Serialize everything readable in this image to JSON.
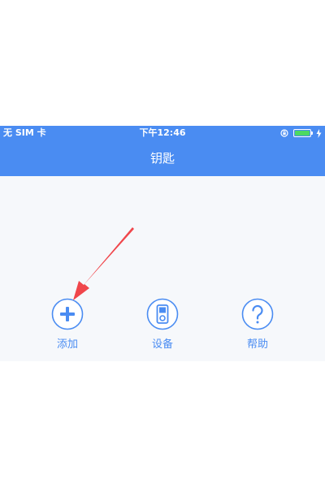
{
  "status_bar": {
    "carrier": "无 SIM 卡",
    "time": "下午12:46",
    "icons": [
      "rotation-lock-icon",
      "battery-icon",
      "charging-bolt-icon"
    ],
    "battery_level": 1.0
  },
  "header": {
    "title": "钥匙"
  },
  "actions": [
    {
      "label": "添加",
      "icon": "plus-circle-icon"
    },
    {
      "label": "设备",
      "icon": "device-icon"
    },
    {
      "label": "帮助",
      "icon": "help-circle-icon"
    }
  ],
  "annotation": {
    "type": "arrow",
    "icon": "red-pointer-arrow",
    "color": "#f0464b"
  },
  "colors": {
    "header_bg": "#4a8cf2",
    "accent": "#4a8cf2",
    "screen_bg": "#f6f8fb",
    "battery": "#4cd964"
  }
}
